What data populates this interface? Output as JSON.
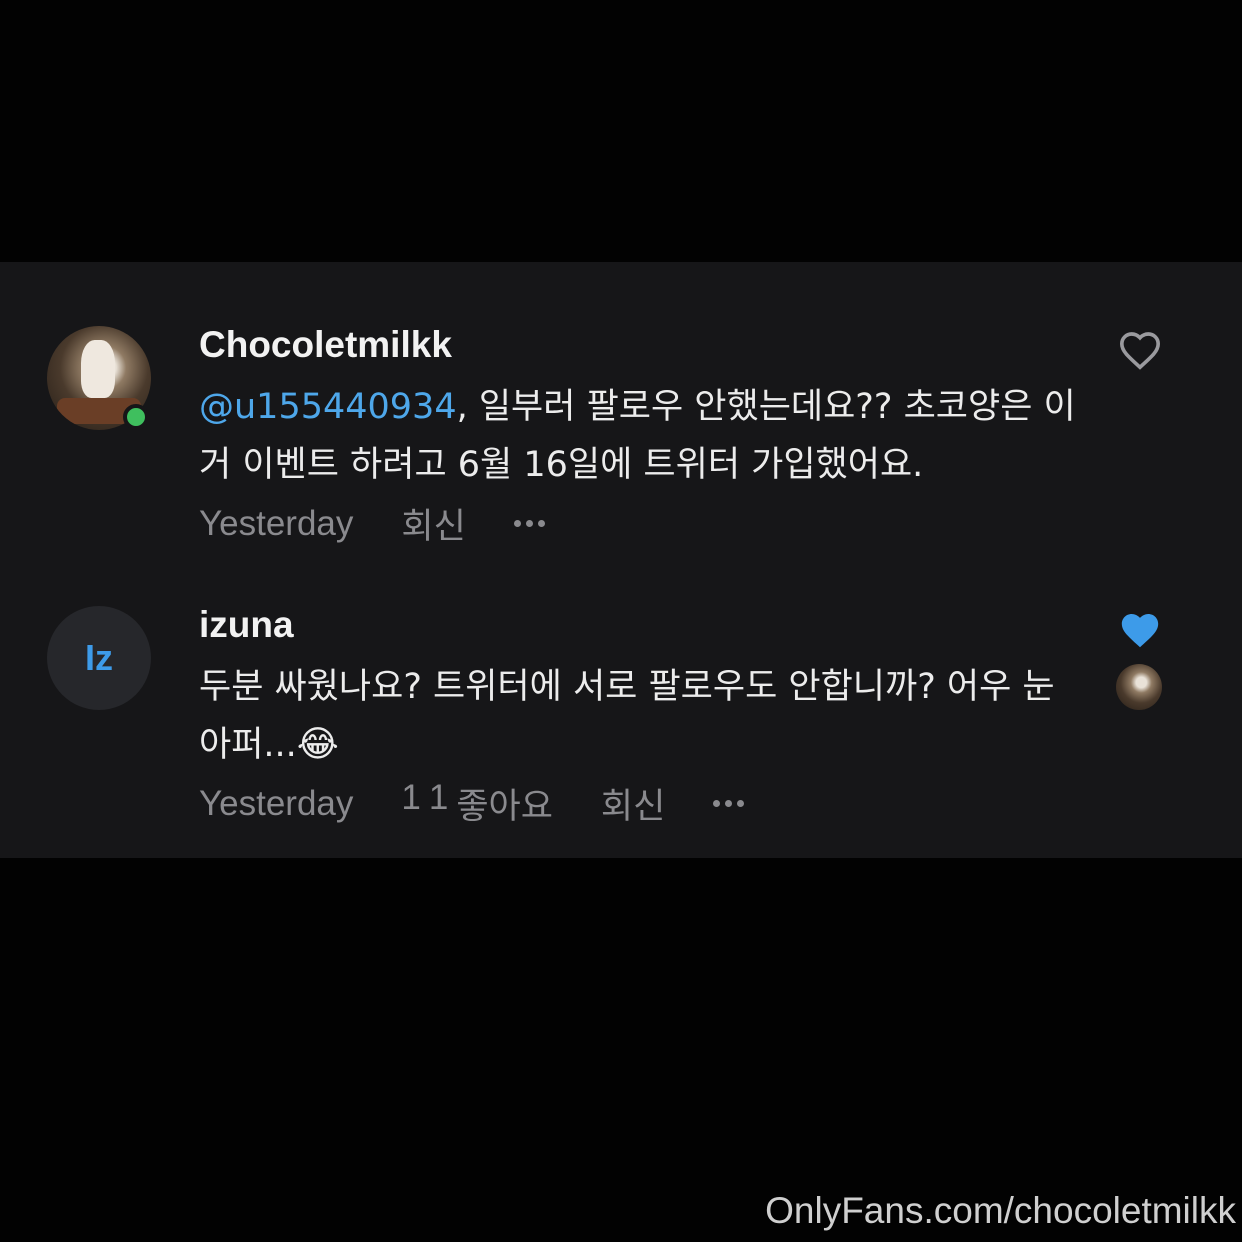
{
  "comments": [
    {
      "username": "Chocoletmilkk",
      "mention": "@u155440934",
      "text": ", 일부러 팔로우 안했는데요?? 초코양은 이거 이벤트 하려고 6월 16일에 트위터 가입했어요.",
      "time": "Yesterday",
      "reply_label": "회신",
      "liked": false
    },
    {
      "username": "izuna",
      "avatar_initials": "Iz",
      "text": "두분 싸웠나요? 트위터에 서로 팔로우도 안합니까? 어우 눈아퍼...",
      "emoji": "😂",
      "time": "Yesterday",
      "like_count": "1",
      "like_count_extra": "1",
      "like_label": "좋아요",
      "reply_label": "회신",
      "liked": true
    }
  ],
  "colors": {
    "accent": "#4ea7ea",
    "heart_liked": "#3d9be9",
    "heart_outline": "#9a9a9e",
    "online": "#3fbf5e"
  },
  "watermark": "OnlyFans.com/chocoletmilkk"
}
